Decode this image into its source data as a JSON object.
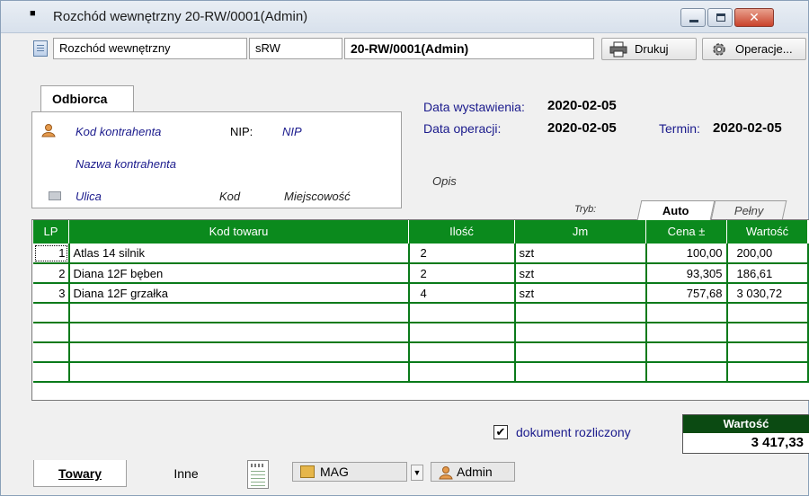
{
  "window": {
    "title": "Rozchód wewnętrzny 20-RW/0001(Admin)",
    "min_glyph": "",
    "max_glyph": "",
    "close_glyph": "✕"
  },
  "toolbar": {
    "doc_type": "Rozchód wewnętrzny",
    "series": "sRW",
    "doc_number": "20-RW/0001(Admin)",
    "print_label": "Drukuj",
    "operations_label": "Operacje..."
  },
  "odbiorca": {
    "tab_label": "Odbiorca",
    "kod_kontrahenta": "Kod kontrahenta",
    "nip_label": "NIP:",
    "nip_value": "NIP",
    "nazwa": "Nazwa kontrahenta",
    "ulica": "Ulica",
    "kod": "Kod",
    "miejscowosc": "Miejscowość"
  },
  "dates": {
    "wystawienia_label": "Data wystawienia:",
    "wystawienia_value": "2020-02-05",
    "operacji_label": "Data operacji:",
    "operacji_value": "2020-02-05",
    "termin_label": "Termin:",
    "termin_value": "2020-02-05",
    "opis_label": "Opis"
  },
  "mode": {
    "tryb_label": "Tryb:",
    "tabs": [
      "Auto",
      "Pełny"
    ],
    "active": "Auto"
  },
  "grid": {
    "columns": [
      "LP",
      "Kod towaru",
      "Ilość",
      "Jm",
      "Cena ±",
      "Wartość"
    ],
    "rows": [
      {
        "lp": "1",
        "kod": "Atlas 14 silnik",
        "ilosc": "2",
        "jm": "szt",
        "cena": "100,00",
        "wartosc": "200,00"
      },
      {
        "lp": "2",
        "kod": "Diana 12F bęben",
        "ilosc": "2",
        "jm": "szt",
        "cena": "93,305",
        "wartosc": "186,61"
      },
      {
        "lp": "3",
        "kod": "Diana 12F grzałka",
        "ilosc": "4",
        "jm": "szt",
        "cena": "757,68",
        "wartosc": "3 030,72"
      }
    ],
    "empty_rows": 4
  },
  "footer": {
    "rozliczony_label": "dokument rozliczony",
    "rozliczony_checked": true,
    "total_label": "Wartość",
    "total_value": "3 417,33"
  },
  "bottom": {
    "tab_towary": "Towary",
    "tab_inne": "Inne",
    "magazyn": "MAG",
    "user": "Admin"
  },
  "colors": {
    "grid_header": "#0b8a1d",
    "grid_lines": "#0a7a1a",
    "total_header": "#0b4a12",
    "label_blue": "#1a1a8c"
  }
}
